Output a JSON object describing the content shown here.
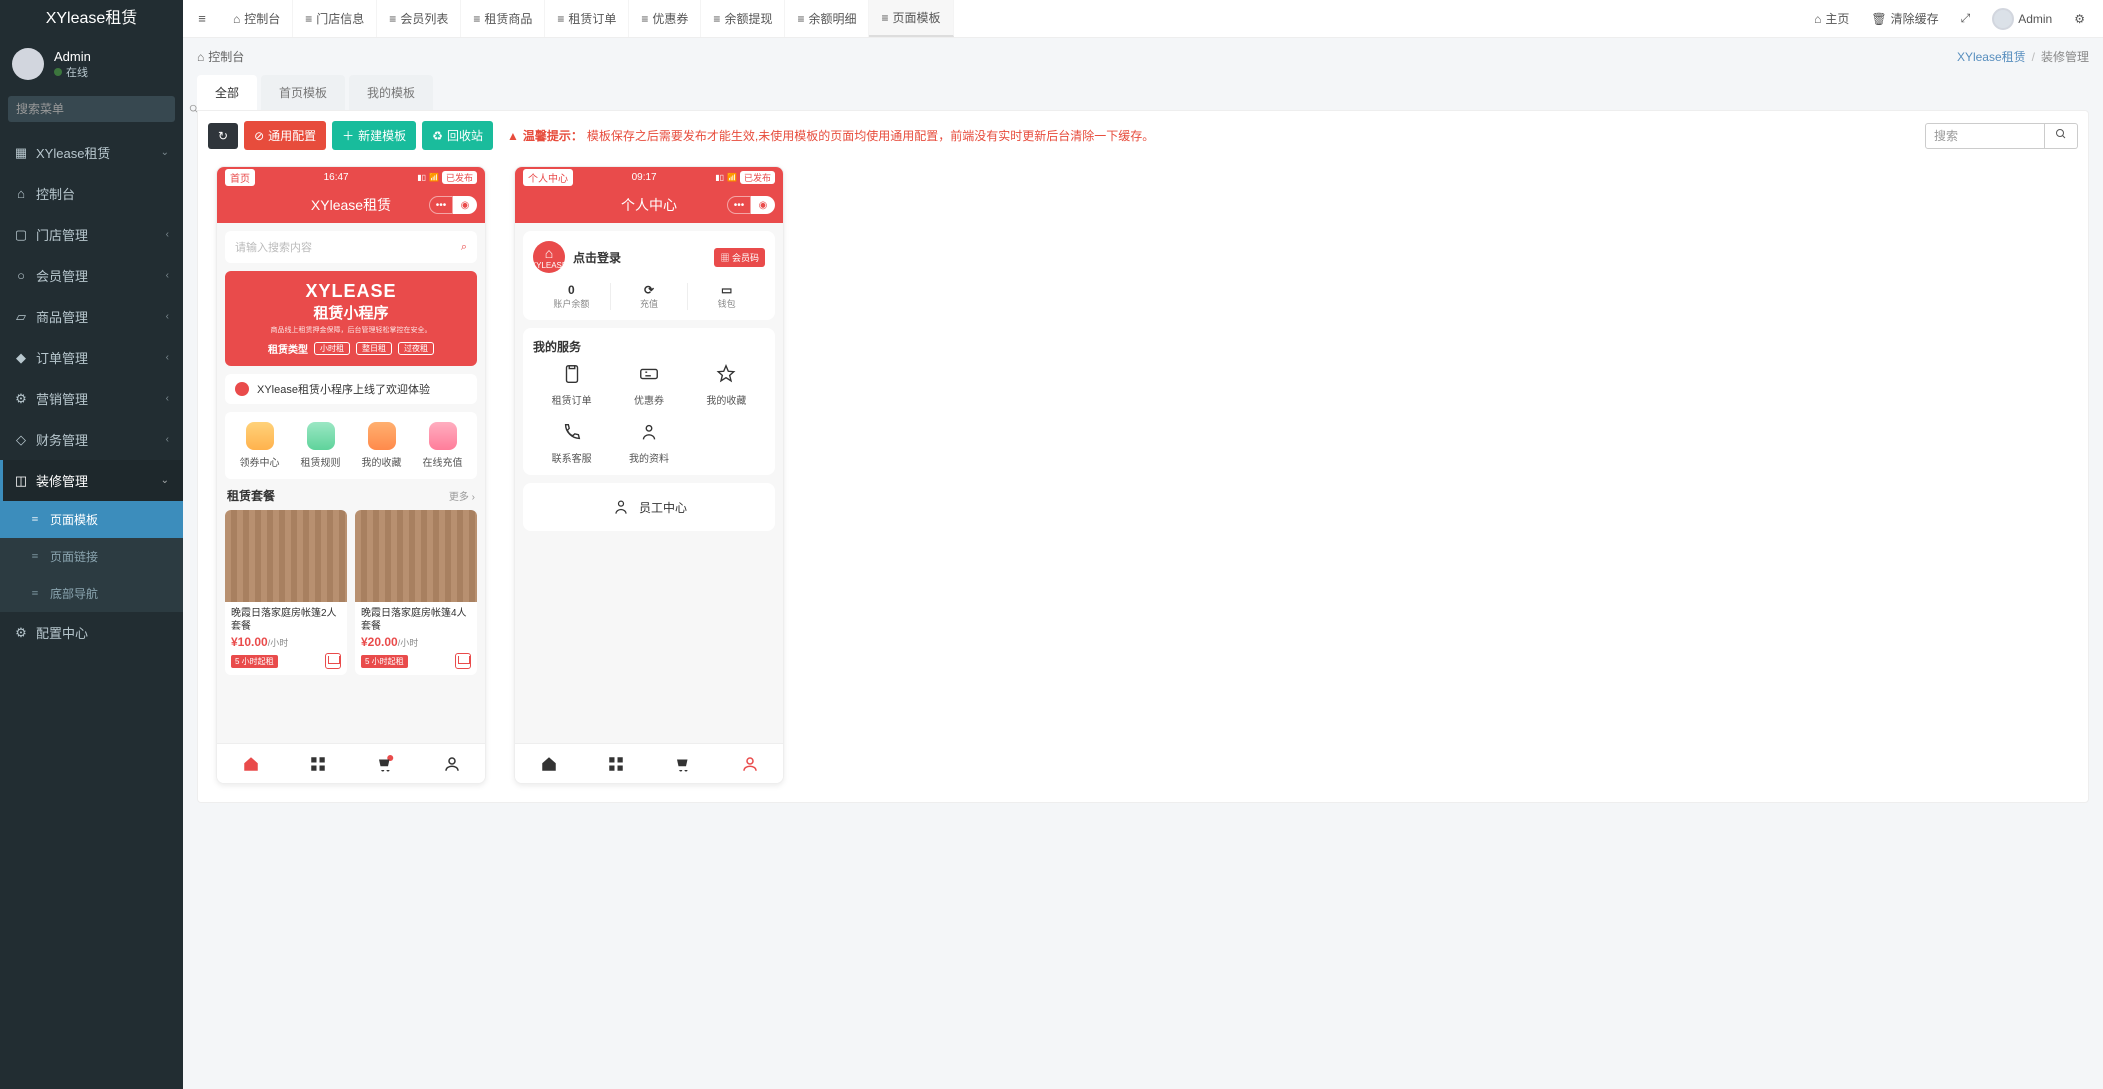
{
  "brand": "XYlease租赁",
  "user": {
    "name": "Admin",
    "status": "在线"
  },
  "search_menu_placeholder": "搜索菜单",
  "sidenav": {
    "root": "XYlease租赁",
    "items": [
      {
        "icon": "⌂",
        "label": "控制台"
      },
      {
        "icon": "▢",
        "label": "门店管理"
      },
      {
        "icon": "○",
        "label": "会员管理"
      },
      {
        "icon": "▱",
        "label": "商品管理"
      },
      {
        "icon": "◆",
        "label": "订单管理"
      },
      {
        "icon": "⚙",
        "label": "营销管理"
      },
      {
        "icon": "◇",
        "label": "财务管理"
      },
      {
        "icon": "◫",
        "label": "装修管理"
      },
      {
        "icon": "⚙",
        "label": "配置中心"
      }
    ],
    "sub_decorate": [
      {
        "label": "页面模板"
      },
      {
        "label": "页面链接"
      },
      {
        "label": "底部导航"
      }
    ]
  },
  "toptabs": [
    {
      "icon": "⌂",
      "label": "控制台"
    },
    {
      "icon": "≡",
      "label": "门店信息"
    },
    {
      "icon": "≡",
      "label": "会员列表"
    },
    {
      "icon": "≡",
      "label": "租赁商品"
    },
    {
      "icon": "≡",
      "label": "租赁订单"
    },
    {
      "icon": "≡",
      "label": "优惠券"
    },
    {
      "icon": "≡",
      "label": "余额提现"
    },
    {
      "icon": "≡",
      "label": "余额明细"
    },
    {
      "icon": "≡",
      "label": "页面模板"
    }
  ],
  "topright": {
    "home": "主页",
    "clear": "清除缓存",
    "user": "Admin"
  },
  "crumb": {
    "left": "控制台",
    "site": "XYlease租赁",
    "page": "装修管理"
  },
  "subtabs": [
    "全部",
    "首页模板",
    "我的模板"
  ],
  "toolbar": {
    "refresh": "↻",
    "general": "通用配置",
    "new": "新建模板",
    "recycle": "回收站",
    "warn_label": "温馨提示：",
    "warn_text": "模板保存之后需要发布才能生效,未使用模板的页面均使用通用配置，前端没有实时更新后台清除一下缓存。",
    "search_placeholder": "搜索"
  },
  "phone_home": {
    "tag": "首页",
    "time": "16:47",
    "pub": "已发布",
    "title": "XYlease租赁",
    "search_ph": "请输入搜索内容",
    "banner": {
      "h1": "XYLEASE",
      "h2": "租赁小程序",
      "sub": "商品线上租赁押金保障，后台管理轻松掌控在安全。",
      "lab": "租赁类型",
      "pills": [
        "小时租",
        "整日租",
        "过夜租"
      ]
    },
    "notice": "XYlease租赁小程序上线了欢迎体验",
    "quick": [
      "领券中心",
      "租赁规则",
      "我的收藏",
      "在线充值"
    ],
    "sect": {
      "title": "租赁套餐",
      "more": "更多"
    },
    "prods": [
      {
        "name": "晚霞日落家庭房帐篷2人套餐",
        "price": "¥10.00",
        "unit": "/小时",
        "tag": "5 小时起租"
      },
      {
        "name": "晚霞日落家庭房帐篷4人套餐",
        "price": "¥20.00",
        "unit": "/小时",
        "tag": "5 小时起租"
      }
    ]
  },
  "phone_me": {
    "tag": "个人中心",
    "time": "09:17",
    "pub": "已发布",
    "title": "个人中心",
    "avatar_label": "XYLEASE",
    "login": "点击登录",
    "member": "会员码",
    "stats": [
      {
        "n": "0",
        "l": "账户余额"
      },
      {
        "n": "⟳",
        "l": "充值"
      },
      {
        "n": "▭",
        "l": "钱包"
      }
    ],
    "svc_title": "我的服务",
    "svcs": [
      "租赁订单",
      "优惠券",
      "我的收藏",
      "联系客服",
      "我的资料"
    ],
    "staff": "员工中心"
  }
}
